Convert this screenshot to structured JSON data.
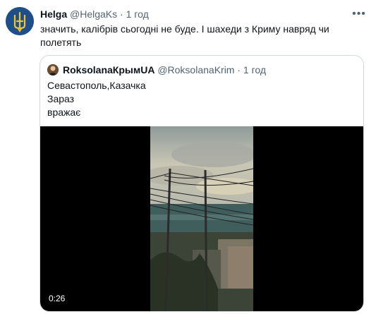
{
  "tweet": {
    "author_name": "Helga",
    "author_handle": "@HelgaKs",
    "separator": "·",
    "time": "1 год",
    "more_icon": "more-horizontal-icon",
    "text": "значить, калібрів сьогодні не буде. І шахеди з Криму навряд чи полетять"
  },
  "quoted": {
    "author_name": "RoksolanaКрымUA",
    "author_handle": "@RoksolanaKrim",
    "separator": "·",
    "time": "1 год",
    "lines": [
      "Севастополь,Казачка",
      "Зараз",
      "вражає"
    ],
    "video": {
      "duration": "0:26"
    }
  },
  "colors": {
    "text": "#0f1419",
    "secondary": "#536471",
    "border": "#cfd9de",
    "avatar": "#1f4f8a"
  }
}
